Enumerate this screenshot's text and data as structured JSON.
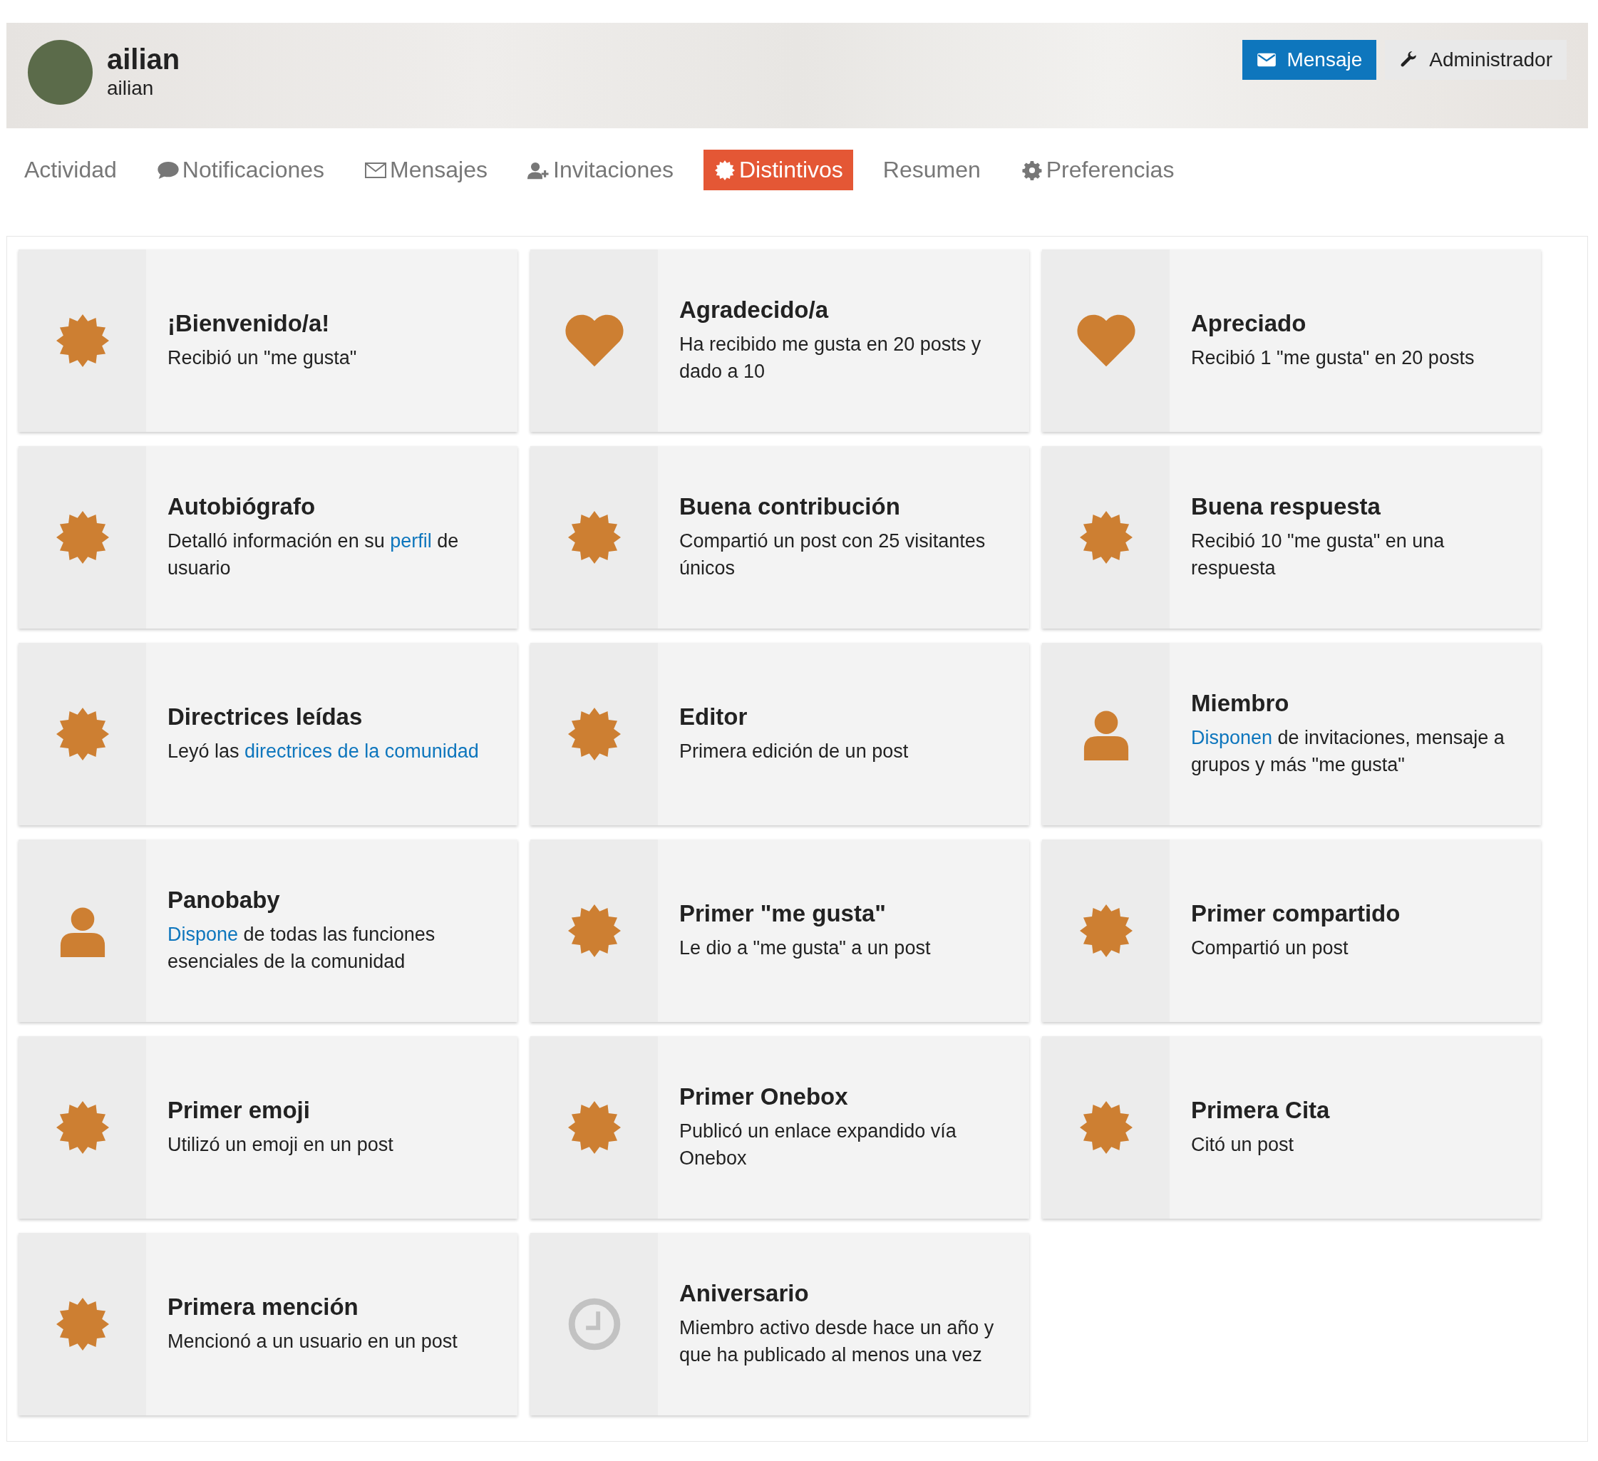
{
  "profile": {
    "name": "ailian",
    "username": "ailian"
  },
  "actions": [
    {
      "label": "Mensaje",
      "kind": "primary"
    },
    {
      "label": "Administrador",
      "kind": "secondary"
    }
  ],
  "tabs": [
    {
      "label": "Actividad",
      "kind": "plain",
      "selected": false
    },
    {
      "label": "Notificaciones",
      "kind": "bubble",
      "selected": false
    },
    {
      "label": "Mensajes",
      "kind": "envelope",
      "selected": false
    },
    {
      "label": "Invitaciones",
      "kind": "invite",
      "selected": false
    },
    {
      "label": "Distintivos",
      "kind": "badge",
      "selected": true
    },
    {
      "label": "Resumen",
      "kind": "plain",
      "selected": false
    },
    {
      "label": "Preferencias",
      "kind": "gear",
      "selected": false
    }
  ],
  "badges": [
    {
      "title": "¡Bienvenido/a!",
      "kind": "badge",
      "description": [
        {
          "text": "Recibió un \"me gusta\"",
          "link": false
        }
      ]
    },
    {
      "title": "Agradecido/a",
      "kind": "heart",
      "description": [
        {
          "text": "Ha recibido me gusta en 20 posts y dado a 10",
          "link": false
        }
      ]
    },
    {
      "title": "Apreciado",
      "kind": "heart",
      "description": [
        {
          "text": "Recibió 1 \"me gusta\" en 20 posts",
          "link": false
        }
      ]
    },
    {
      "title": "Autobiógrafo",
      "kind": "badge",
      "description": [
        {
          "text": "Detalló información en su ",
          "link": false
        },
        {
          "text": "perfil",
          "link": true
        },
        {
          "text": " de usuario",
          "link": false
        }
      ]
    },
    {
      "title": "Buena contribución",
      "kind": "badge",
      "description": [
        {
          "text": "Compartió un post con 25 visitantes únicos",
          "link": false
        }
      ]
    },
    {
      "title": "Buena respuesta",
      "kind": "badge",
      "description": [
        {
          "text": "Recibió 10 \"me gusta\" en una respuesta",
          "link": false
        }
      ]
    },
    {
      "title": "Directrices leídas",
      "kind": "badge",
      "description": [
        {
          "text": "Leyó las ",
          "link": false
        },
        {
          "text": "directrices de la comunidad",
          "link": true
        }
      ]
    },
    {
      "title": "Editor",
      "kind": "badge",
      "description": [
        {
          "text": "Primera edición de un post",
          "link": false
        }
      ]
    },
    {
      "title": "Miembro",
      "kind": "person",
      "description": [
        {
          "text": "Disponen",
          "link": true
        },
        {
          "text": " de invitaciones, mensaje a grupos y más \"me gusta\"",
          "link": false
        }
      ]
    },
    {
      "title": "Panobaby",
      "kind": "person",
      "description": [
        {
          "text": "Dispone",
          "link": true
        },
        {
          "text": " de todas las funciones esenciales de la comunidad",
          "link": false
        }
      ]
    },
    {
      "title": "Primer \"me gusta\"",
      "kind": "badge",
      "description": [
        {
          "text": "Le dio a \"me gusta\" a un post",
          "link": false
        }
      ]
    },
    {
      "title": "Primer compartido",
      "kind": "badge",
      "description": [
        {
          "text": "Compartió un post",
          "link": false
        }
      ]
    },
    {
      "title": "Primer emoji",
      "kind": "badge",
      "description": [
        {
          "text": "Utilizó un emoji en un post",
          "link": false
        }
      ]
    },
    {
      "title": "Primer Onebox",
      "kind": "badge",
      "description": [
        {
          "text": "Publicó un enlace expandido vía Onebox",
          "link": false
        }
      ]
    },
    {
      "title": "Primera Cita",
      "kind": "badge",
      "description": [
        {
          "text": "Citó un post",
          "link": false
        }
      ]
    },
    {
      "title": "Primera mención",
      "kind": "badge",
      "description": [
        {
          "text": "Mencionó a un usuario en un post",
          "link": false
        }
      ]
    },
    {
      "title": "Aniversario",
      "kind": "clock",
      "description": [
        {
          "text": "Miembro activo desde hace un año y que ha publicado al menos una vez",
          "link": false
        }
      ]
    }
  ]
}
